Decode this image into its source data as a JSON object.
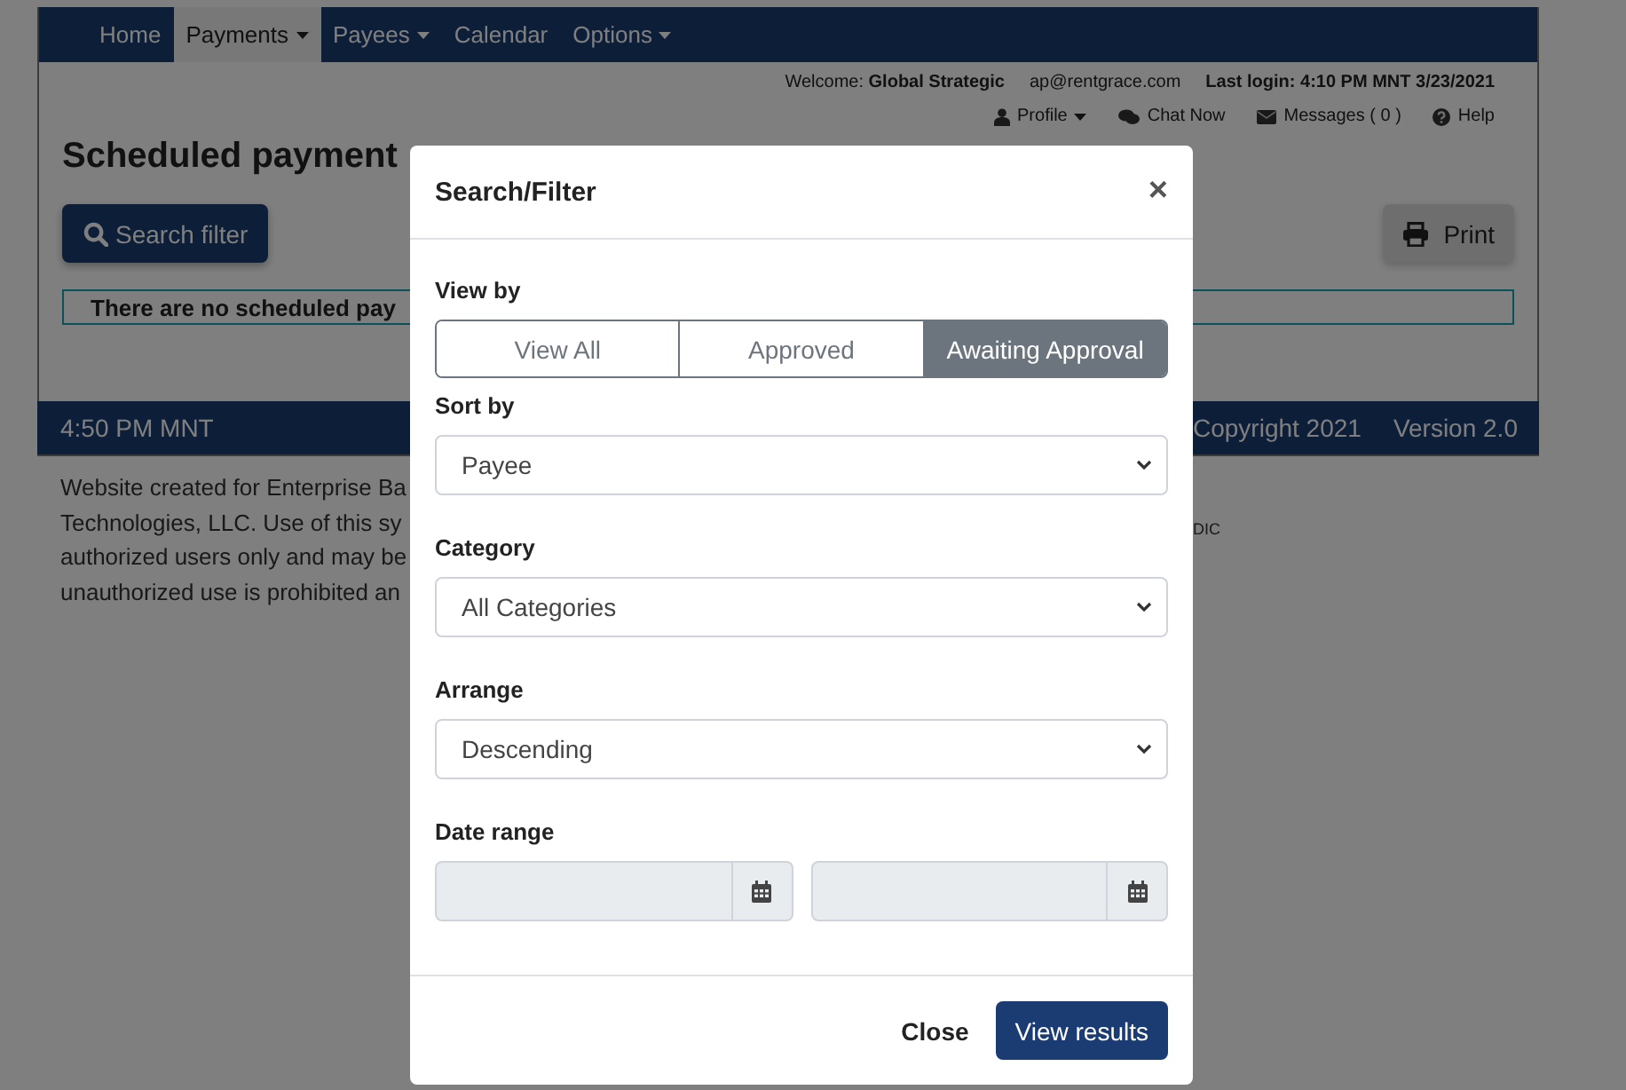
{
  "nav": {
    "items": [
      {
        "label": "Home",
        "dropdown": false,
        "selected": false
      },
      {
        "label": "Payments",
        "dropdown": true,
        "selected": true
      },
      {
        "label": "Payees",
        "dropdown": true,
        "selected": false
      },
      {
        "label": "Calendar",
        "dropdown": false,
        "selected": false
      },
      {
        "label": "Options",
        "dropdown": true,
        "selected": false
      }
    ]
  },
  "user_bar": {
    "welcome": "Welcome: **Global Strategic**",
    "email": "ap@rentgrace.com",
    "last_login": "Last login: 4:10 PM MNT 3/23/2021",
    "links": [
      {
        "label": "Profile",
        "dropdown": true
      },
      {
        "label": "Chat Now",
        "dropdown": false
      },
      {
        "label": "Messages ( 0 )",
        "dropdown": false
      },
      {
        "label": "Help",
        "dropdown": false
      }
    ]
  },
  "page": {
    "title": "Scheduled payment",
    "search_button": "Search filter",
    "print_button": "Print",
    "notice": "There are no scheduled pay"
  },
  "footer": {
    "time": "4:50 PM MNT",
    "copyright": "Copyright 2021",
    "version": "Version 2.0",
    "disclaimer_lines": [
      "Website created for Enterprise Ba",
      "Technologies, LLC. Use of this sy",
      "authorized users only and may be",
      "unauthorized use is prohibited an"
    ],
    "disclaimer_tail": "DIC"
  },
  "modal": {
    "title": "Search/Filter",
    "close": "×",
    "view_by": {
      "label": "View by",
      "segments": [
        {
          "label": "View All",
          "selected": false
        },
        {
          "label": "Approved",
          "selected": false
        },
        {
          "label": "Awaiting Approval",
          "selected": true
        }
      ]
    },
    "fields": [
      {
        "label": "Sort by",
        "kind": "select",
        "value": "Payee"
      },
      {
        "label": "Category",
        "kind": "select",
        "value": "All Categories"
      },
      {
        "label": "Arrange",
        "kind": "select",
        "value": "Descending"
      },
      {
        "label": "Date range",
        "kind": "date_range",
        "disabled": true
      }
    ],
    "buttons": [
      {
        "label": "Close",
        "kind": "link"
      },
      {
        "label": "View results",
        "kind": "primary"
      }
    ]
  }
}
